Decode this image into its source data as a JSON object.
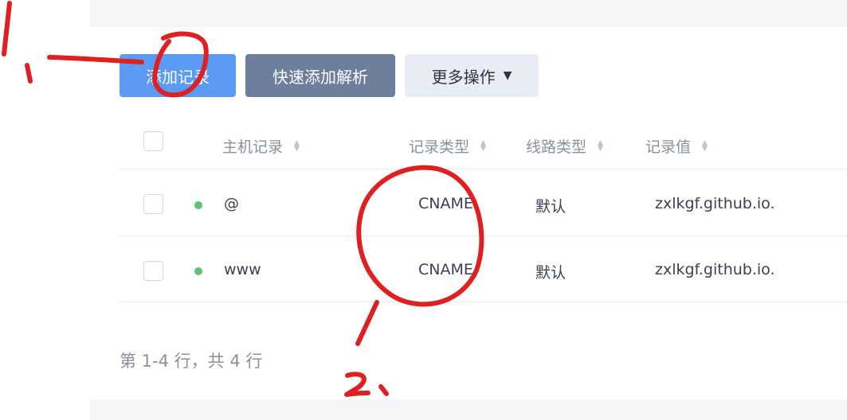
{
  "toolbar": {
    "add_record": "添加记录",
    "quick_add": "快速添加解析",
    "more_actions": "更多操作"
  },
  "table": {
    "headers": {
      "host": "主机记录",
      "type": "记录类型",
      "line": "线路类型",
      "value": "记录值"
    },
    "rows": [
      {
        "host": "@",
        "type": "CNAME",
        "line": "默认",
        "value": "zxlkgf.github.io.",
        "status": "active"
      },
      {
        "host": "www",
        "type": "CNAME",
        "line": "默认",
        "value": "zxlkgf.github.io.",
        "status": "active"
      }
    ]
  },
  "pagination": {
    "summary": "第 1-4 行，共 4 行"
  },
  "annotations": {
    "marks": [
      "1",
      "2"
    ],
    "color": "#e02020"
  }
}
